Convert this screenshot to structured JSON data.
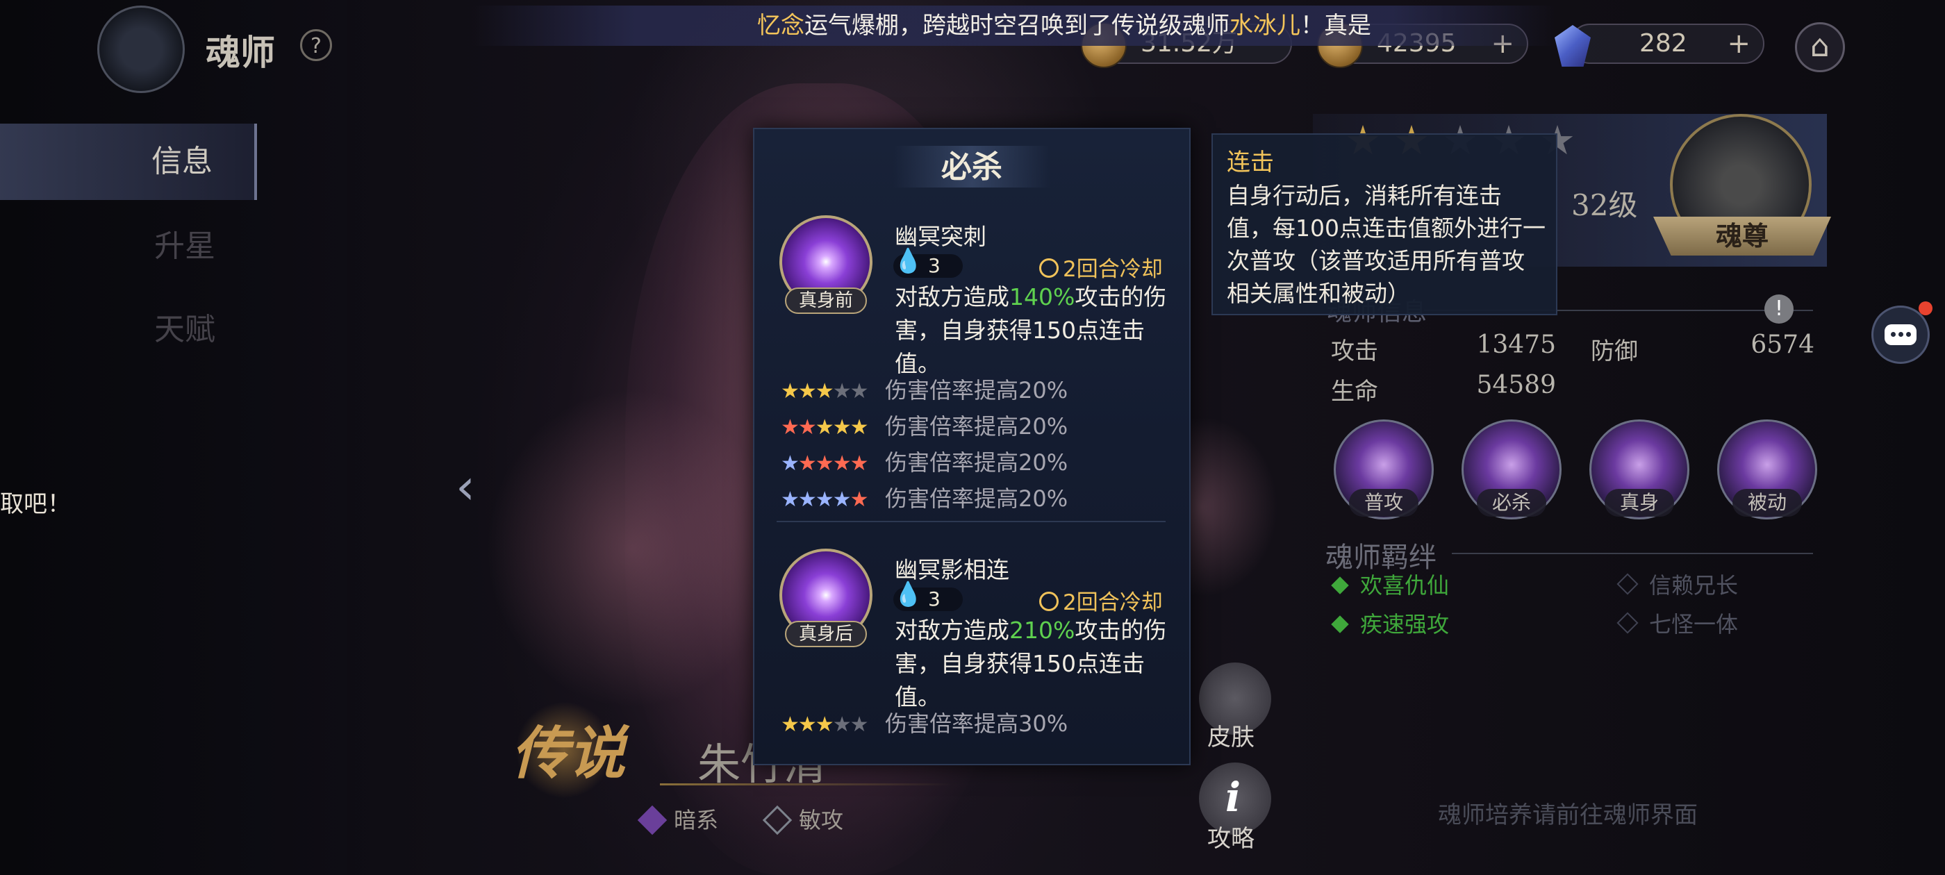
{
  "broadcast": {
    "player": "忆念",
    "part1": "运气爆棚，跨越时空召唤到了传说级魂师",
    "hero": "水冰儿",
    "part2": "！真是"
  },
  "currency": [
    {
      "icon": "gold-coin-icon",
      "value": "31.52万"
    },
    {
      "icon": "soul-coin-icon",
      "value": "42395"
    },
    {
      "icon": "diamond-icon",
      "value": "282"
    }
  ],
  "header": {
    "title": "魂师",
    "help": "?"
  },
  "nav": {
    "tabs": [
      "信息",
      "升星",
      "天赋"
    ]
  },
  "left_marquee": "取吧！",
  "popup": {
    "title": "必杀",
    "skills": [
      {
        "name": "幽冥突刺",
        "tag": "真身前",
        "cost": "3",
        "cooldown": "2回合冷却",
        "desc_pre": "对敌方造成",
        "desc_hl": "140%",
        "desc_post": "攻击的伤害，自身获得150点连击值。",
        "upgrades": [
          {
            "stars": "★★★★★",
            "text": "伤害倍率提高20%"
          },
          {
            "stars": "★★★★★",
            "text": "伤害倍率提高20%"
          },
          {
            "stars": "★★★★★",
            "text": "伤害倍率提高20%"
          },
          {
            "stars": "★★★★★",
            "text": "伤害倍率提高20%"
          }
        ]
      },
      {
        "name": "幽冥影相连",
        "tag": "真身后",
        "cost": "3",
        "cooldown": "2回合冷却",
        "desc_pre": "对敌方造成",
        "desc_hl": "210%",
        "desc_post": "攻击的伤害，自身获得150点连击值。",
        "upgrades": [
          {
            "stars": "★★★★★",
            "text": "伤害倍率提高30%"
          }
        ]
      }
    ]
  },
  "tooltip": {
    "title": "连击",
    "body": "自身行动后，消耗所有连击值，每100点连击值额外进行一次普攻（该普攻适用所有普攻相关属性和被动）"
  },
  "rank": {
    "level": "32级",
    "title": "魂尊",
    "stars_total": 5
  },
  "attributes": {
    "header": "魂师信息",
    "stats": [
      {
        "label": "攻击",
        "value": "13475"
      },
      {
        "label": "防御",
        "value": "6574"
      },
      {
        "label": "生命",
        "value": "54589"
      }
    ]
  },
  "skill_buttons": [
    "普攻",
    "必杀",
    "真身",
    "被动"
  ],
  "bonds": {
    "header": "魂师羁绊",
    "items": [
      {
        "name": "欢喜仇仙",
        "active": true
      },
      {
        "name": "信赖兄长",
        "active": false
      },
      {
        "name": "疾速强攻",
        "active": true
      },
      {
        "name": "七怪一体",
        "active": false
      }
    ]
  },
  "train_hint": "魂师培养请前往魂师界面",
  "character": {
    "rarity": "传说",
    "name": "朱竹清",
    "element": "暗系",
    "role": "敏攻"
  },
  "side_buttons": {
    "skin": "皮肤",
    "guide": "攻略"
  },
  "colors": {
    "accent_gold": "#f4c55a",
    "highlight_green": "#5fd14f",
    "panel_bg": "#182238"
  }
}
